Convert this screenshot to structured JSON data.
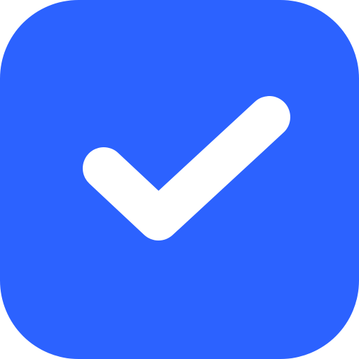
{
  "checkbox": {
    "checked": true,
    "icon": "check-icon",
    "background_color": "#2C62FF",
    "check_color": "#FFFFFF"
  }
}
